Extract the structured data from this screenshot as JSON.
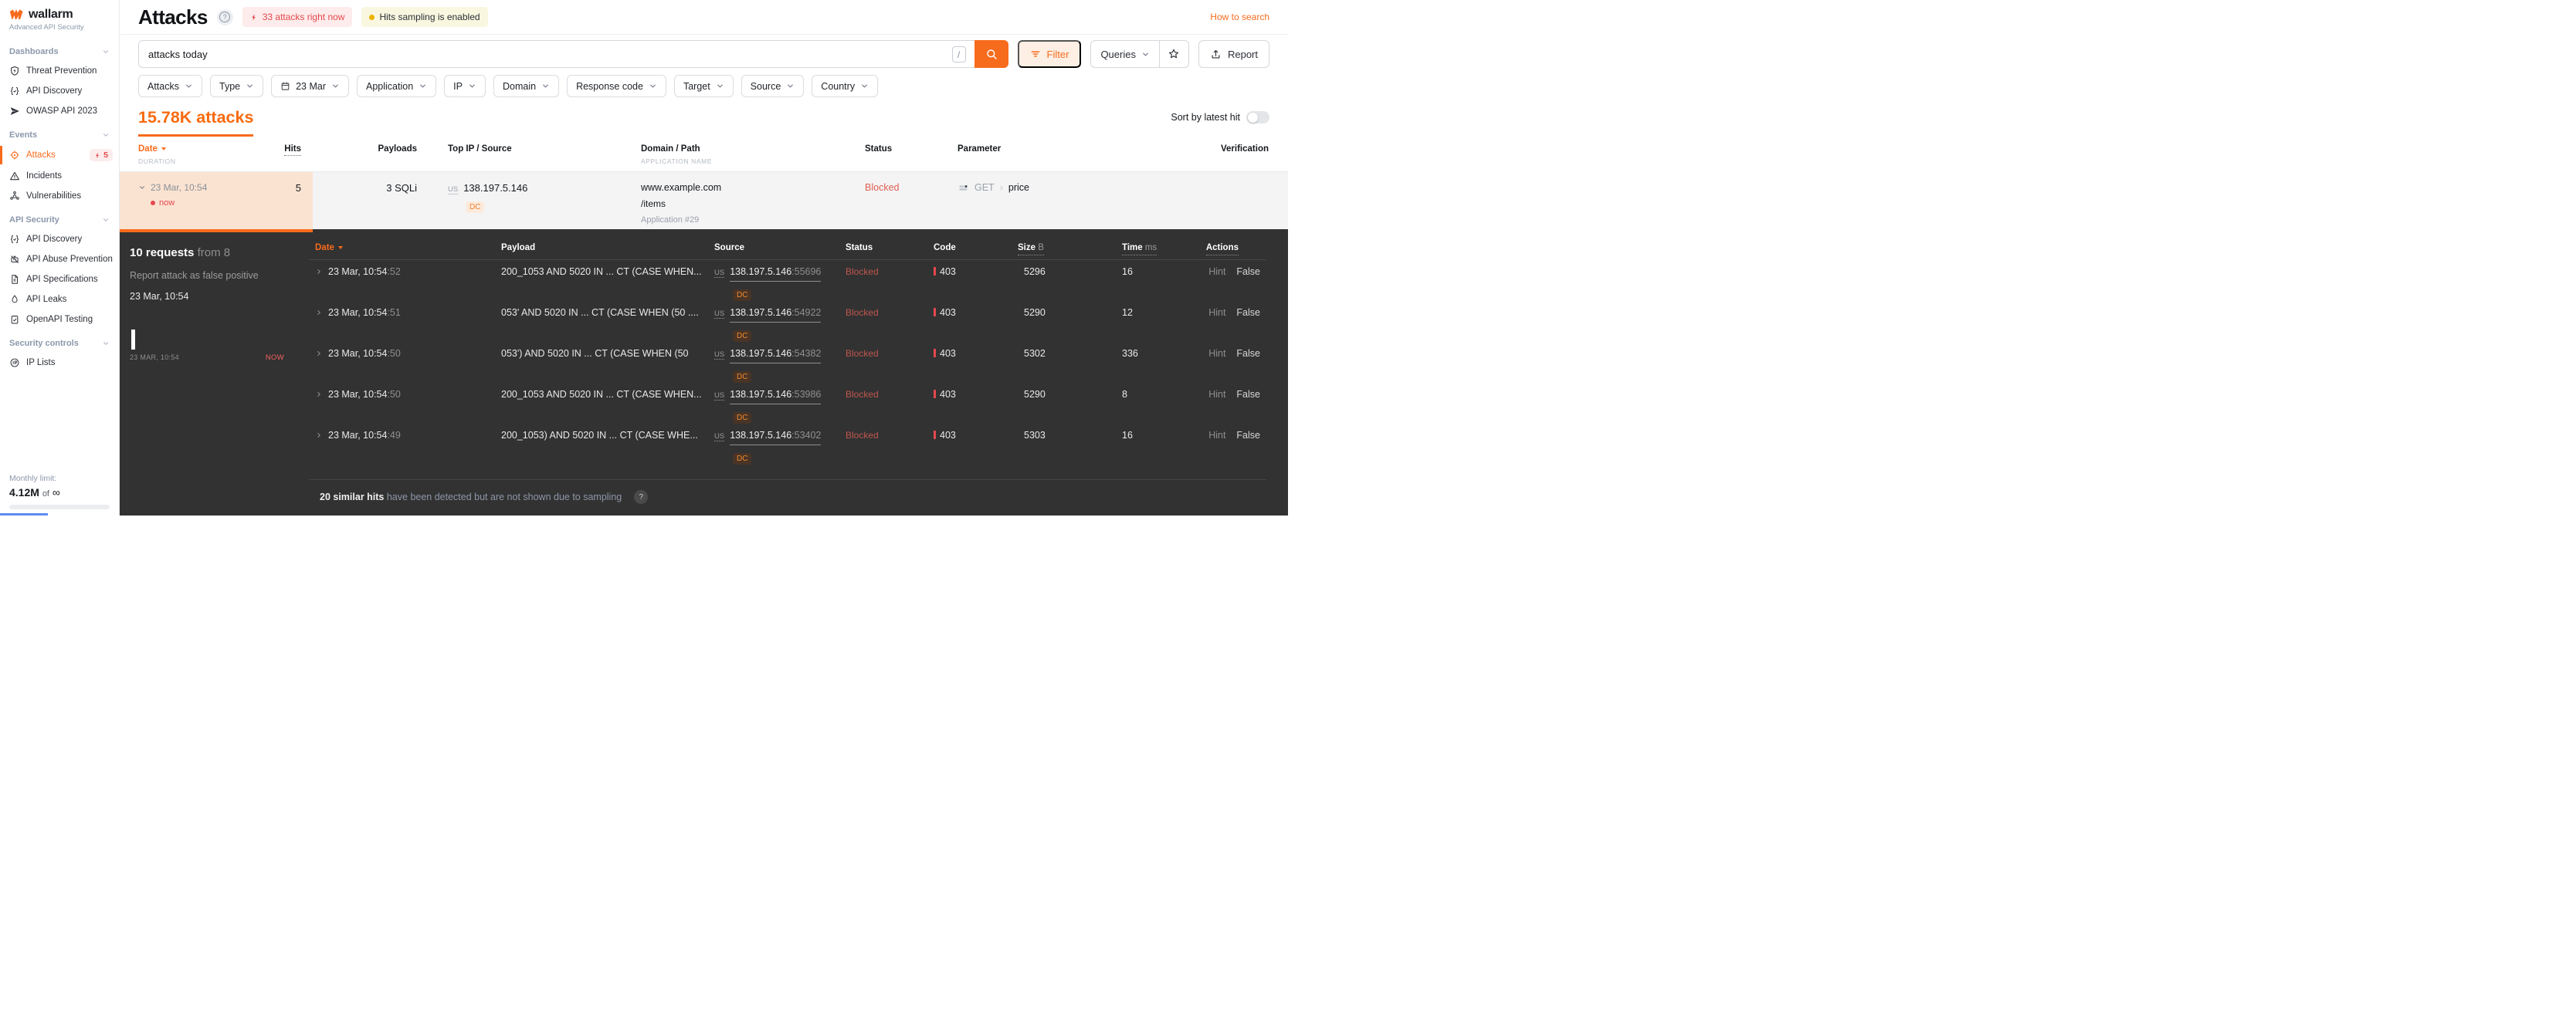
{
  "brand": {
    "name": "wallarm",
    "subtitle": "Advanced API Security"
  },
  "sidebar": {
    "sections": [
      {
        "label": "Dashboards",
        "items": [
          {
            "label": "Threat Prevention",
            "icon": "shield-bolt-icon"
          },
          {
            "label": "API Discovery",
            "icon": "braces-check-icon"
          },
          {
            "label": "OWASP API 2023",
            "icon": "paper-plane-icon"
          }
        ]
      },
      {
        "label": "Events",
        "items": [
          {
            "label": "Attacks",
            "icon": "target-icon",
            "active": true,
            "badge": "5"
          },
          {
            "label": "Incidents",
            "icon": "warning-triangle-icon"
          },
          {
            "label": "Vulnerabilities",
            "icon": "biohazard-icon"
          }
        ]
      },
      {
        "label": "API Security",
        "items": [
          {
            "label": "API Discovery",
            "icon": "braces-check-icon"
          },
          {
            "label": "API Abuse Prevention",
            "icon": "bot-icon"
          },
          {
            "label": "API Specifications",
            "icon": "document-icon"
          },
          {
            "label": "API Leaks",
            "icon": "droplet-icon"
          },
          {
            "label": "OpenAPI Testing",
            "icon": "clipboard-check-icon"
          }
        ]
      },
      {
        "label": "Security controls",
        "items": [
          {
            "label": "IP Lists",
            "icon": "ip-circle-icon"
          }
        ]
      }
    ],
    "monthly_limit": {
      "label": "Monthly limit:",
      "used": "4.12M",
      "of": "of",
      "total": "∞"
    }
  },
  "header": {
    "title": "Attacks",
    "help_glyph": "?",
    "attacks_now_badge": "33 attacks right now",
    "sampling_badge": "Hits sampling is enabled",
    "how_to_search": "How to search"
  },
  "toolbar": {
    "search_value": "attacks today",
    "search_shortcut": "/",
    "filter_label": "Filter",
    "queries_label": "Queries",
    "report_label": "Report"
  },
  "filters": [
    {
      "label": "Attacks"
    },
    {
      "label": "Type"
    },
    {
      "label": "23 Mar",
      "icon": "calendar-icon"
    },
    {
      "label": "Application"
    },
    {
      "label": "IP"
    },
    {
      "label": "Domain"
    },
    {
      "label": "Response code"
    },
    {
      "label": "Target"
    },
    {
      "label": "Source"
    },
    {
      "label": "Country"
    }
  ],
  "summary": {
    "count": "15.78K attacks",
    "sort_label": "Sort by latest hit"
  },
  "attack_table": {
    "headers": {
      "date": "Date",
      "duration": "DURATION",
      "hits": "Hits",
      "payloads": "Payloads",
      "top_ip": "Top IP / Source",
      "domain": "Domain / Path",
      "application": "APPLICATION NAME",
      "status": "Status",
      "parameter": "Parameter",
      "verification": "Verification"
    },
    "row": {
      "date": "23 Mar, 10:54",
      "live": "now",
      "hits": "5",
      "payloads": "3 SQLi",
      "country": "US",
      "ip": "138.197.5.146",
      "ip_tag": "DC",
      "domain": "www.example.com",
      "path": "/items",
      "application": "Application #29",
      "status": "Blocked",
      "method": "GET",
      "method_sep": "›",
      "parameter": "price"
    }
  },
  "details": {
    "requests_count": "10 requests",
    "requests_from": "from 8",
    "report_link": "Report attack as false positive",
    "started": "23 Mar, 10:54",
    "timeline_start": "23 MAR, 10:54",
    "timeline_end": "NOW",
    "headers": {
      "date": "Date",
      "payload": "Payload",
      "source": "Source",
      "status": "Status",
      "code": "Code",
      "size": "Size",
      "size_unit": "B",
      "time": "Time",
      "time_unit": "ms",
      "actions": "Actions"
    },
    "rows": [
      {
        "date": "23 Mar, 10:54",
        "seconds": ":52",
        "payload": "200_1053 AND 5020 IN ... CT (CASE WHEN...",
        "country": "US",
        "ip": "138.197.5.146",
        "port": ":55696",
        "tag": "DC",
        "status": "Blocked",
        "code": "403",
        "size": "5296",
        "time": "16",
        "action_hint": "Hint",
        "action_false": "False"
      },
      {
        "date": "23 Mar, 10:54",
        "seconds": ":51",
        "payload": "053' AND 5020 IN ... CT (CASE WHEN (50 ....",
        "country": "US",
        "ip": "138.197.5.146",
        "port": ":54922",
        "tag": "DC",
        "status": "Blocked",
        "code": "403",
        "size": "5290",
        "time": "12",
        "action_hint": "Hint",
        "action_false": "False"
      },
      {
        "date": "23 Mar, 10:54",
        "seconds": ":50",
        "payload": "053') AND 5020 IN ... CT (CASE WHEN (50",
        "country": "US",
        "ip": "138.197.5.146",
        "port": ":54382",
        "tag": "DC",
        "status": "Blocked",
        "code": "403",
        "size": "5302",
        "time": "336",
        "action_hint": "Hint",
        "action_false": "False"
      },
      {
        "date": "23 Mar, 10:54",
        "seconds": ":50",
        "payload": "200_1053 AND 5020 IN ... CT (CASE WHEN...",
        "country": "US",
        "ip": "138.197.5.146",
        "port": ":53986",
        "tag": "DC",
        "status": "Blocked",
        "code": "403",
        "size": "5290",
        "time": "8",
        "action_hint": "Hint",
        "action_false": "False"
      },
      {
        "date": "23 Mar, 10:54",
        "seconds": ":49",
        "payload": "200_1053) AND 5020 IN ... CT (CASE WHE...",
        "country": "US",
        "ip": "138.197.5.146",
        "port": ":53402",
        "tag": "DC",
        "status": "Blocked",
        "code": "403",
        "size": "5303",
        "time": "16",
        "action_hint": "Hint",
        "action_false": "False"
      }
    ],
    "footer": {
      "bold": "20 similar hits",
      "rest": "have been detected but are not shown due to sampling",
      "help_glyph": "?"
    }
  },
  "colors": {
    "accent": "#f76b1c",
    "danger": "#e5484d",
    "danger_soft_bg": "#fdeceb",
    "sampling_bg": "#f9f7df",
    "sampling_dot": "#eeb200",
    "selected_row_bg": "#fbe3d2",
    "row_bg": "#f4f4f5",
    "panel_bg": "#323232",
    "blocked_light": "#e05e52",
    "blocked_dark": "#bf564e",
    "dc_tag": "#ef7f2e"
  }
}
